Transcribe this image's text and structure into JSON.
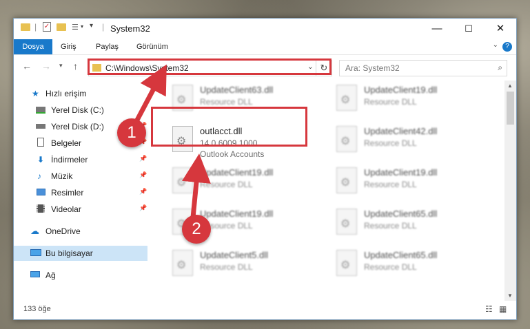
{
  "window": {
    "title": "System32",
    "controls": {
      "minimize": "—",
      "maximize": "☐",
      "close": "✕"
    }
  },
  "ribbon": {
    "tabs": [
      "Dosya",
      "Giriş",
      "Paylaş",
      "Görünüm"
    ],
    "help": "?"
  },
  "address": {
    "path": "C:\\Windows\\System32",
    "search_placeholder": "Ara: System32"
  },
  "nav": {
    "items": [
      {
        "label": "Hızlı erişim",
        "icon": "star-icon"
      },
      {
        "label": "Yerel Disk (C:)",
        "icon": "drive-icon",
        "pinned": true
      },
      {
        "label": "Yerel Disk (D:)",
        "icon": "drive-icon",
        "pinned": true
      },
      {
        "label": "Belgeler",
        "icon": "documents-icon",
        "pinned": true
      },
      {
        "label": "İndirmeler",
        "icon": "download-icon",
        "pinned": true
      },
      {
        "label": "Müzik",
        "icon": "music-icon",
        "pinned": true
      },
      {
        "label": "Resimler",
        "icon": "pictures-icon",
        "pinned": true
      },
      {
        "label": "Videolar",
        "icon": "videos-icon",
        "pinned": true
      },
      {
        "label": "OneDrive",
        "icon": "cloud-icon"
      },
      {
        "label": "Bu bilgisayar",
        "icon": "computer-icon",
        "selected": true
      },
      {
        "label": "Ağ",
        "icon": "network-icon"
      }
    ]
  },
  "files": {
    "left": [
      {
        "name": "UpdateClient63.dll",
        "type": "Resource DLL"
      },
      {
        "name": "outlacct.dll",
        "version": "14.0.6009.1000",
        "type": "Outlook Accounts",
        "highlight": true
      },
      {
        "name": "UpdateClient19.dll",
        "type": "Resource DLL"
      },
      {
        "name": "UpdateClient19.dll",
        "type": "Resource DLL"
      },
      {
        "name": "UpdateClient5.dll",
        "type": "Resource DLL"
      }
    ],
    "right": [
      {
        "name": "UpdateClient19.dll",
        "type": "Resource DLL"
      },
      {
        "name": "UpdateClient42.dll",
        "type": "Resource DLL"
      },
      {
        "name": "UpdateClient19.dll",
        "type": "Resource DLL"
      },
      {
        "name": "UpdateClient65.dll",
        "type": "Resource DLL"
      },
      {
        "name": "UpdateClient65.dll",
        "type": "Resource DLL"
      }
    ]
  },
  "status": {
    "count": "133 öğe"
  },
  "callouts": {
    "first": "1",
    "second": "2"
  },
  "colors": {
    "accent": "#1979ca",
    "highlight": "#d6373d",
    "folder": "#e8c151"
  }
}
